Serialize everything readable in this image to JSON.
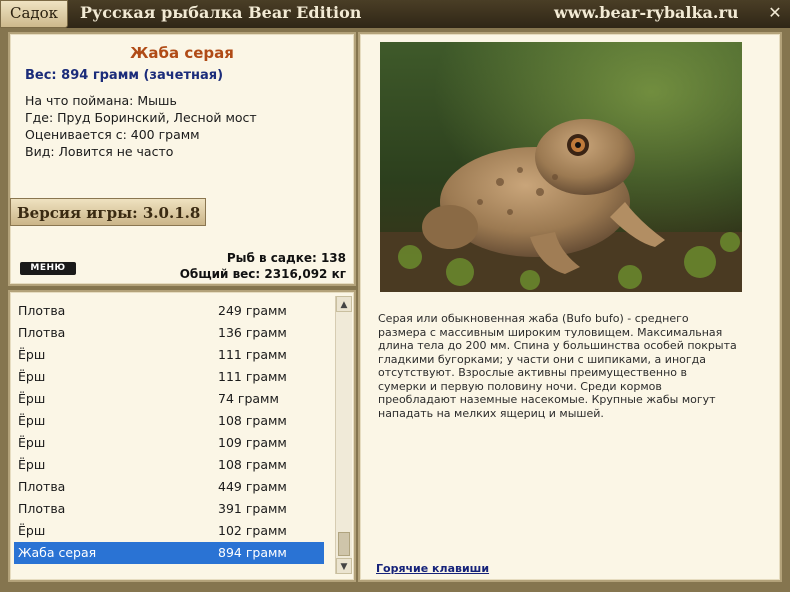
{
  "titlebar": {
    "tab_label": "Садок",
    "app_title": "Русская рыбалка Bear Edition",
    "site": "www.bear-rybalka.ru",
    "close_glyph": "✕"
  },
  "fish": {
    "name": "Жаба серая",
    "weight": "Вес: 894 грамм (зачетная)",
    "details": [
      "На что поймана: Мышь",
      "Где: Пруд Боринский, Лесной мост",
      "Оценивается с: 400 грамм",
      "Вид: Ловится не часто"
    ]
  },
  "version": "Версия игры: 3.0.1.8",
  "menu_label": "МЕНЮ",
  "stats": {
    "count": "Рыб в садке: 138",
    "total": "Общий вес: 2316,092 кг"
  },
  "catch_list": [
    {
      "name": "Плотва",
      "weight": "249 грамм"
    },
    {
      "name": "Плотва",
      "weight": "136 грамм"
    },
    {
      "name": "Ёрш",
      "weight": "111 грамм"
    },
    {
      "name": "Ёрш",
      "weight": "111 грамм"
    },
    {
      "name": "Ёрш",
      "weight": "74 грамм"
    },
    {
      "name": "Ёрш",
      "weight": "108 грамм"
    },
    {
      "name": "Ёрш",
      "weight": "109 грамм"
    },
    {
      "name": "Ёрш",
      "weight": "108 грамм"
    },
    {
      "name": "Плотва",
      "weight": "449 грамм"
    },
    {
      "name": "Плотва",
      "weight": "391 грамм"
    },
    {
      "name": "Ёрш",
      "weight": "102 грамм"
    },
    {
      "name": "Жаба серая",
      "weight": "894 грамм",
      "selected": true
    }
  ],
  "description": "Серая или обыкновенная жаба (Bufo bufo) - среднего размера с массивным широким туловищем. Максимальная длина тела до 200 мм. Спина у большинства особей покрыта гладкими бугорками; у части они с шипиками, а иногда отсутствуют. Взрослые активны преимущественно в сумерки и первую половину ночи. Среди кормов преобладают наземные насекомые. Крупные жабы могут нападать на мелких ящериц и мышей.",
  "hotkeys_link": "Горячие клавиши",
  "colors": {
    "fish_name": "#b04b16",
    "weight": "#1b2c7a",
    "selection": "#2a73d4"
  }
}
